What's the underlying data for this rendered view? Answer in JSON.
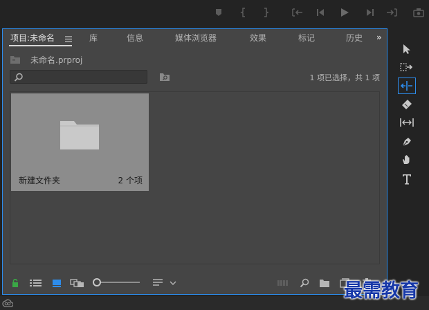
{
  "tabs": [
    {
      "label": "项目:未命名"
    },
    {
      "label": "库"
    },
    {
      "label": "信息"
    },
    {
      "label": "媒体浏览器"
    },
    {
      "label": "效果"
    },
    {
      "label": "标记"
    },
    {
      "label": "历史"
    }
  ],
  "overflow_label": "»",
  "project": {
    "file_name": "未命名.prproj"
  },
  "search": {
    "value": "",
    "placeholder": ""
  },
  "selection_status": "1 项已选择，共 1 项",
  "bin": {
    "name": "新建文件夹",
    "count": "2 个项"
  },
  "zoom": {
    "value": 0.0
  },
  "watermark": "最需教育",
  "colors": {
    "panel_bg": "#454545",
    "accent": "#2d8ceb",
    "tile_bg": "#8c8c8c",
    "lock_green": "#3aa845",
    "watermark": "#1738a8"
  },
  "icons": {
    "transport": [
      "marker-icon",
      "mark-in-icon",
      "mark-out-icon",
      "go-to-in-icon",
      "step-back-icon",
      "play-icon",
      "step-forward-icon",
      "go-to-out-icon",
      "export-frame-icon"
    ],
    "tools": [
      "selection-tool-icon",
      "track-select-tool-icon",
      "ripple-edit-tool-icon",
      "razor-tool-icon",
      "slip-tool-icon",
      "pen-tool-icon",
      "hand-tool-icon",
      "type-tool-icon"
    ],
    "bottom": [
      "lock-icon",
      "list-view-icon",
      "icon-view-icon",
      "freeform-view-icon",
      "zoom-slider",
      "sort-icon",
      "automate-sequence-icon",
      "find-icon",
      "new-bin-icon",
      "new-item-icon",
      "clear-icon"
    ]
  }
}
